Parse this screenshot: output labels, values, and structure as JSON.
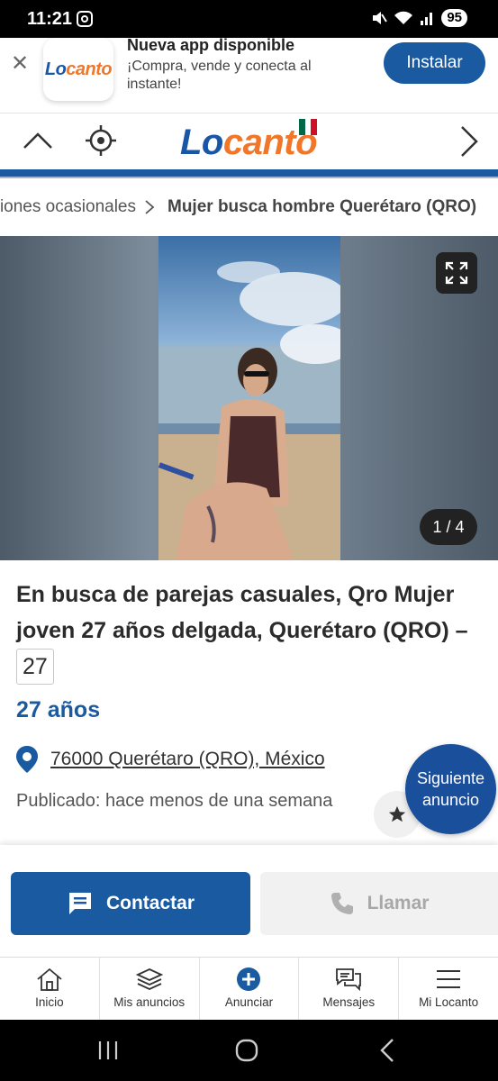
{
  "status_bar": {
    "time": "11:21",
    "battery": "95"
  },
  "app_banner": {
    "logo_part1": "Lo",
    "logo_part2": "canto",
    "title": "Nueva app disponible",
    "subtitle": "¡Compra, vende y conecta al instante!",
    "install_label": "Instalar"
  },
  "header": {
    "logo_part1": "Lo",
    "logo_part2": "canto",
    "flag_colors": [
      "#006847",
      "#ffffff",
      "#ce1126"
    ]
  },
  "breadcrumb": {
    "previous": "Relaciones ocasionales",
    "current": "Mujer busca hombre Querétaro (QRO)"
  },
  "gallery": {
    "counter": "1 / 4"
  },
  "listing": {
    "title": "En busca de parejas casuales, Qro Mujer joven 27 años delgada, Querétaro (QRO) –",
    "age_badge": "27",
    "age": "27 años",
    "location": "76000 Querétaro (QRO), México",
    "published": "Publicado: hace menos de una semana",
    "next_ad": "Siguiente anuncio"
  },
  "actions": {
    "contact": "Contactar",
    "call": "Llamar"
  },
  "bottom_nav": [
    {
      "label": "Inicio",
      "icon": "home-icon"
    },
    {
      "label": "Mis anuncios",
      "icon": "stack-icon"
    },
    {
      "label": "Anunciar",
      "icon": "plus-circle-icon"
    },
    {
      "label": "Mensajes",
      "icon": "chat-icon"
    },
    {
      "label": "Mi Locanto",
      "icon": "menu-icon"
    }
  ],
  "colors": {
    "brand_blue": "#1a5aa0",
    "brand_orange": "#f0772a"
  }
}
